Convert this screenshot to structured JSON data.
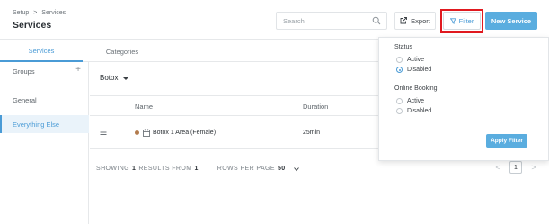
{
  "header": {
    "breadcrumb": [
      "Setup",
      ">",
      "Services"
    ],
    "title": "Services",
    "search_placeholder": "Search",
    "export_label": "Export",
    "filter_label": "Filter",
    "new_service_label": "New Service"
  },
  "tabs": [
    {
      "label": "Services",
      "active": true
    },
    {
      "label": "Categories",
      "active": false
    }
  ],
  "sidebar": {
    "items": [
      {
        "label": "Groups",
        "active": false
      },
      {
        "label": "General",
        "active": false
      },
      {
        "label": "Everything Else",
        "active": true
      }
    ],
    "add_symbol": "+"
  },
  "main": {
    "category_select": "Botox",
    "columns": [
      "Name",
      "Duration"
    ],
    "rows": [
      {
        "name": "Botox 1 Area (Female)",
        "duration": "25min",
        "color": "#b27b4d"
      }
    ],
    "footer": {
      "showing_label": "SHOWING",
      "showing_count": "1",
      "results_from_label": "RESULTS FROM",
      "results_total": "1",
      "rows_per_page_label": "ROWS PER PAGE",
      "rows_per_page_value": "50"
    },
    "pagination": {
      "prev": "<",
      "current": "1",
      "next": ">"
    }
  },
  "filter_panel": {
    "status_title": "Status",
    "status_options": [
      {
        "label": "Active",
        "checked": false
      },
      {
        "label": "Disabled",
        "checked": true
      }
    ],
    "online_booking_title": "Online Booking",
    "online_booking_options": [
      {
        "label": "Active",
        "checked": false
      },
      {
        "label": "Disabled",
        "checked": false
      }
    ],
    "apply_label": "Apply Filter"
  },
  "colors": {
    "accent": "#4a9bd6",
    "primary_button": "#5aaddf",
    "highlight": "#e0191f"
  }
}
